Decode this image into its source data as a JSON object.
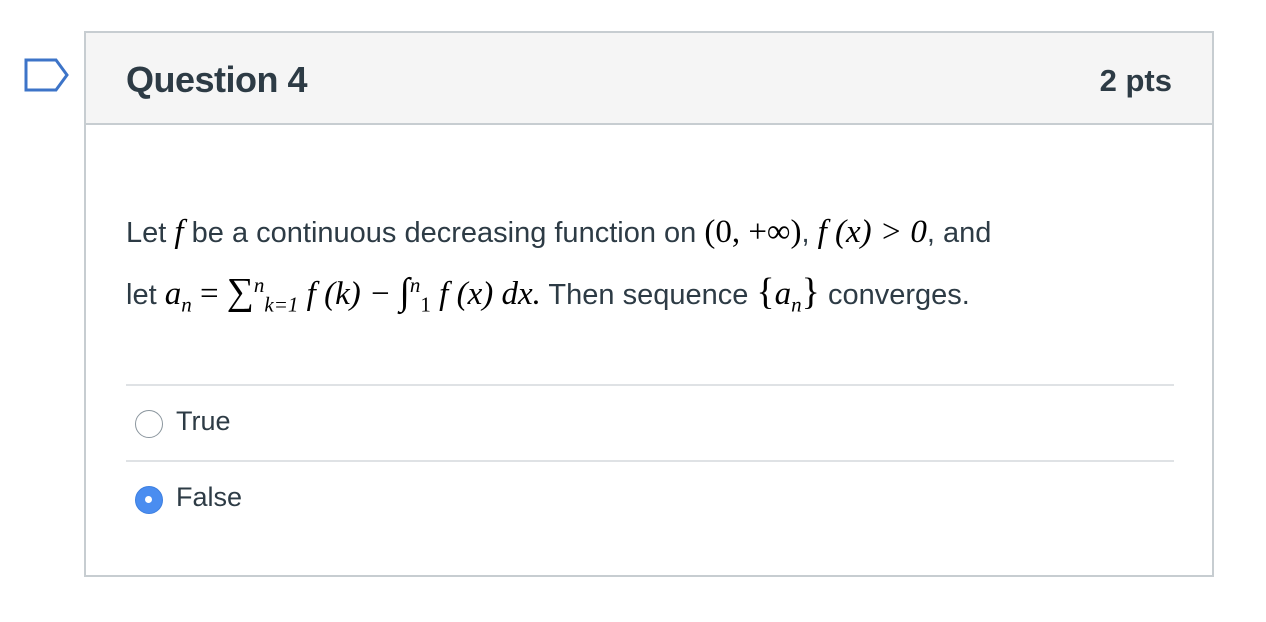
{
  "question": {
    "title": "Question 4",
    "points": "2 pts",
    "text": {
      "t_let": "Let",
      "f": "f",
      "t_be": "be a continuous decreasing function on",
      "interval": "(0,  +∞)",
      "t_comma1": ",",
      "fx_gt0": "f (x) > 0",
      "t_and": ", and",
      "t_let2": "let",
      "a": "a",
      "n_sub": "n",
      "eq": " = ",
      "sum": "∑",
      "sum_sup": "n",
      "sum_sub": "k=1",
      "fk": " f (k) − ",
      "int": "∫",
      "int_sup": "n",
      "int_sub": "1",
      "fx_dx": " f (x) dx.",
      "t_then": "Then sequence",
      "seq_open": "{",
      "seq_a": "a",
      "seq_n": "n",
      "seq_close": "}",
      "t_conv": "converges."
    }
  },
  "answers": [
    {
      "label": "True",
      "selected": false
    },
    {
      "label": "False",
      "selected": true
    }
  ],
  "colors": {
    "accent": "#4a8df0",
    "header_bg": "#f5f5f5",
    "border": "#c7cdd1",
    "text": "#2d3b45",
    "flag": "#3d74c8"
  },
  "icons": {
    "flag": "bookmark-flag-icon"
  }
}
